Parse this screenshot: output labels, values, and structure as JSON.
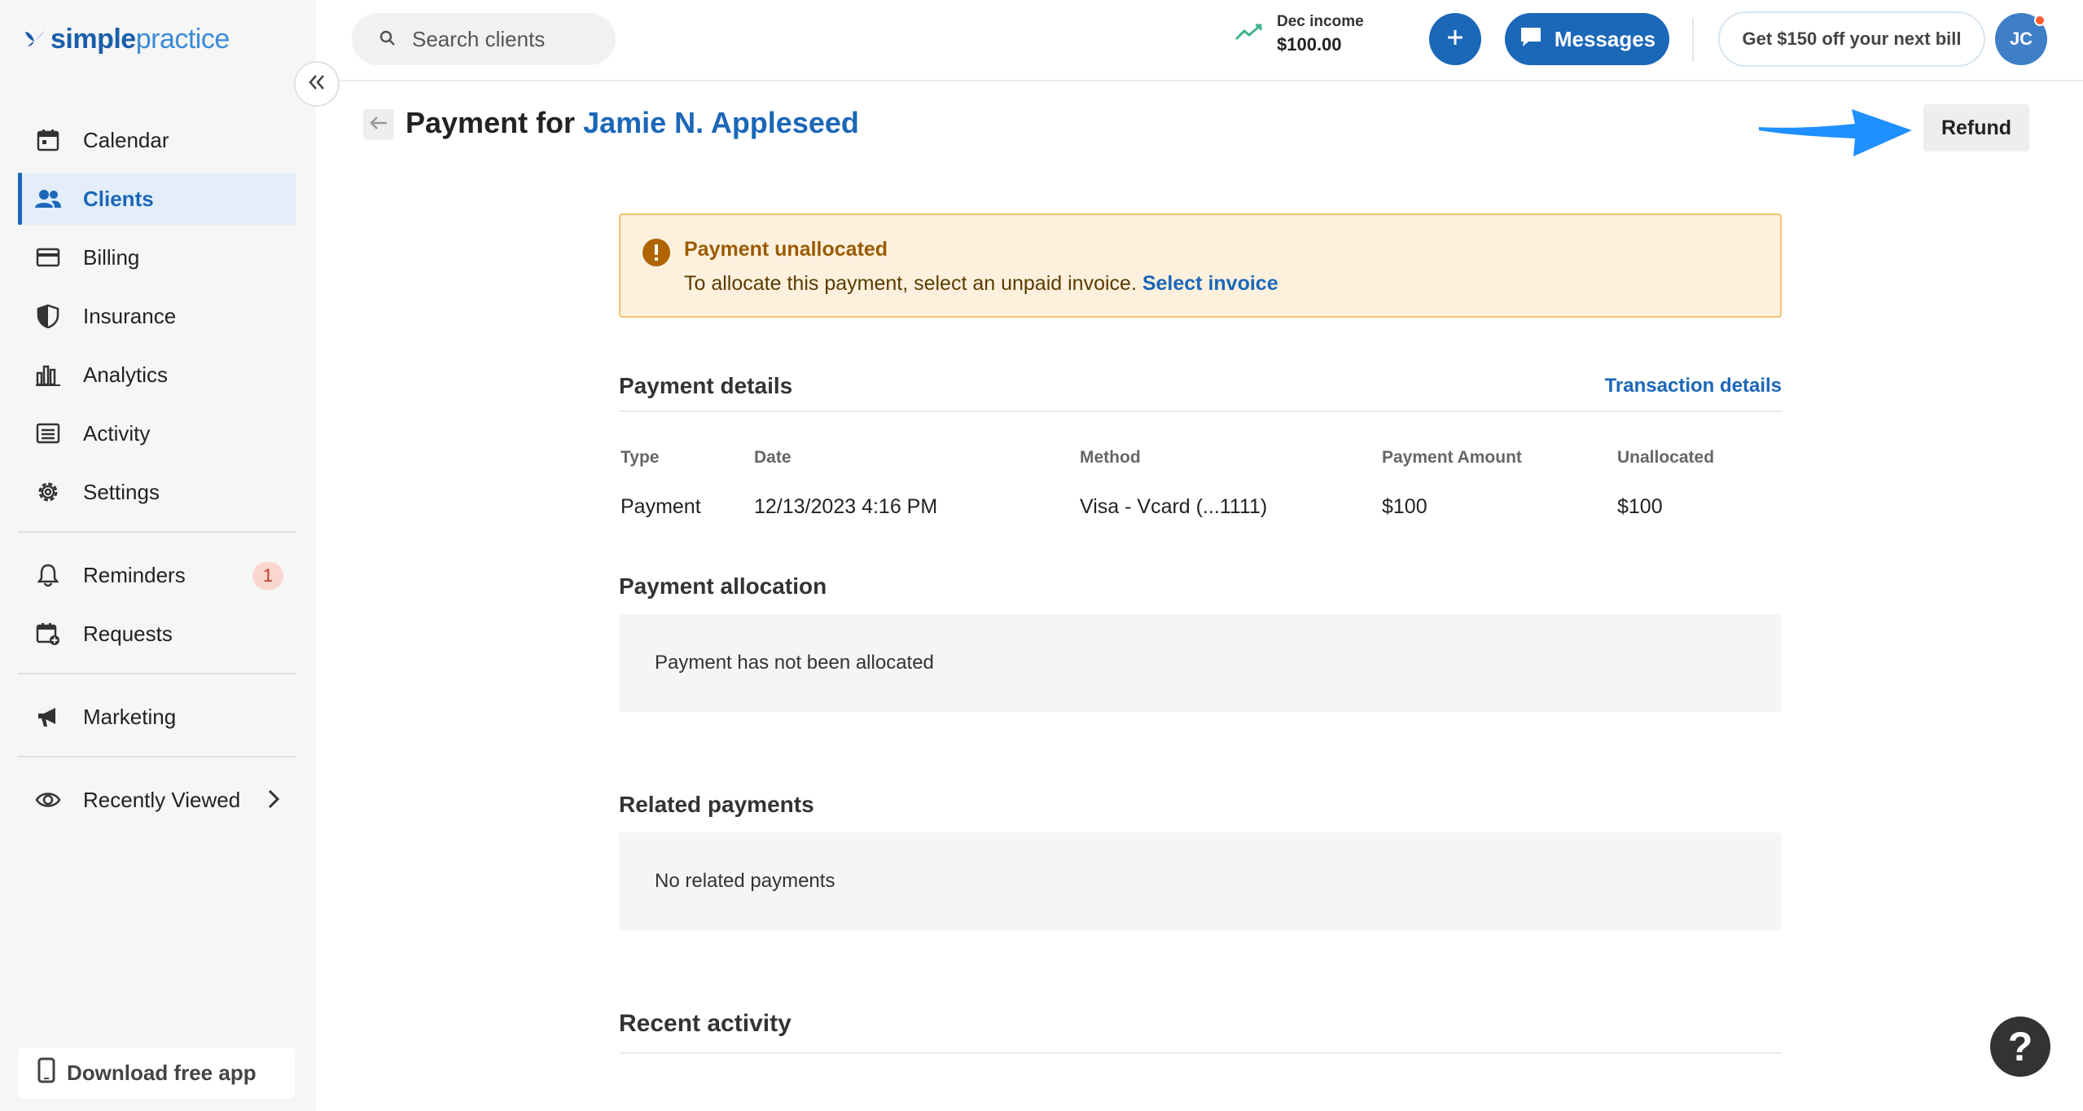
{
  "brand": {
    "simple": "simple",
    "practice": "practice"
  },
  "sidebar": {
    "items": [
      {
        "label": "Calendar",
        "icon": "calendar-icon"
      },
      {
        "label": "Clients",
        "icon": "clients-icon",
        "active": true
      },
      {
        "label": "Billing",
        "icon": "billing-icon"
      },
      {
        "label": "Insurance",
        "icon": "insurance-icon"
      },
      {
        "label": "Analytics",
        "icon": "analytics-icon"
      },
      {
        "label": "Activity",
        "icon": "activity-icon"
      },
      {
        "label": "Settings",
        "icon": "settings-icon"
      }
    ],
    "reminders": {
      "label": "Reminders",
      "count": "1"
    },
    "requests": {
      "label": "Requests"
    },
    "marketing": {
      "label": "Marketing"
    },
    "recently_viewed": {
      "label": "Recently Viewed"
    },
    "download_app": "Download free app"
  },
  "topbar": {
    "search_placeholder": "Search clients",
    "income_label": "Dec income",
    "income_value": "$100.00",
    "plus_label": "+",
    "messages_label": "Messages",
    "promo_label": "Get $150 off your next bill",
    "avatar_initials": "JC"
  },
  "page": {
    "title_prefix": "Payment for",
    "client_name": "Jamie N. Appleseed",
    "refund_label": "Refund"
  },
  "alert": {
    "title": "Payment unallocated",
    "message": "To allocate this payment, select an unpaid invoice.",
    "link": "Select invoice"
  },
  "payment_details": {
    "heading": "Payment details",
    "link": "Transaction details",
    "columns": [
      "Type",
      "Date",
      "Method",
      "Payment Amount",
      "Unallocated"
    ],
    "row": [
      "Payment",
      "12/13/2023 4:16 PM",
      "Visa - Vcard (...1111)",
      "$100",
      "$100"
    ]
  },
  "payment_allocation": {
    "heading": "Payment allocation",
    "empty": "Payment has not been allocated"
  },
  "related_payments": {
    "heading": "Related payments",
    "empty": "No related payments"
  },
  "recent_activity": {
    "heading": "Recent activity"
  },
  "help_label": "?",
  "colors": {
    "primary": "#1b67b8",
    "alert_bg": "#fdf1de",
    "alert_border": "#f2c46f",
    "annotation_arrow": "#1e90ff"
  }
}
